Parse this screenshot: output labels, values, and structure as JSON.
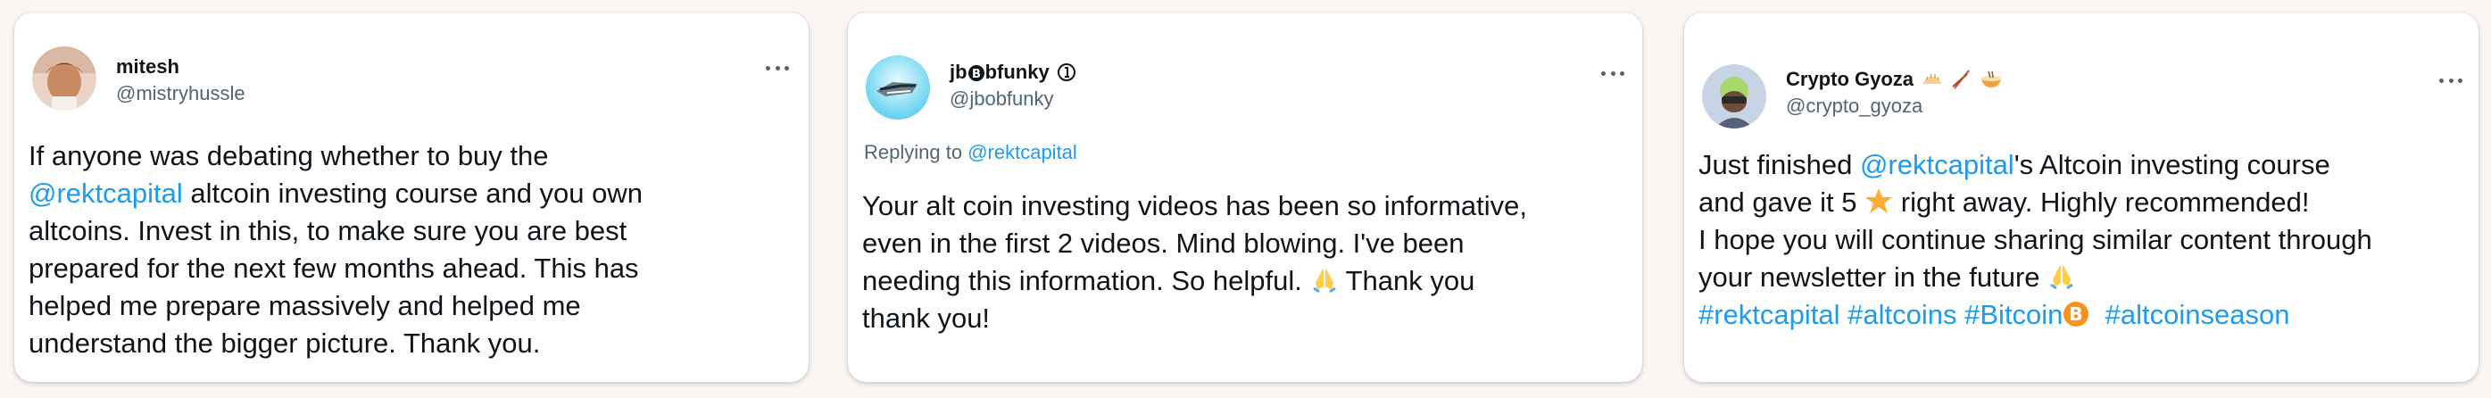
{
  "tweets": [
    {
      "name": "mitesh",
      "handle": "@mistryhussle",
      "body": {
        "l1": "If anyone was debating whether to buy the",
        "l2_link": "@rektcapital",
        "l2_rest": " altcoin investing course and you own",
        "l3": "altcoins. Invest in this, to make sure you are best",
        "l4": "prepared for the next few months ahead. This has",
        "l5": "helped me prepare massively and helped me",
        "l6": "understand the bigger picture. Thank you."
      }
    },
    {
      "name_part1": "jb",
      "name_part2": "bfunky",
      "handle": "@jbobfunky",
      "reply_prefix": "Replying to",
      "reply_link": "@rektcapital",
      "body": {
        "l1": "Your alt coin investing videos has been so informative,",
        "l2": "even in the first 2 videos. Mind blowing. I've been",
        "l3_a": "needing this information. So helpful.",
        "l3_b": "Thank you",
        "l4": "thank you!"
      }
    },
    {
      "name": "Crypto Gyoza",
      "handle": "@crypto_gyoza",
      "body": {
        "l1_a": "Just finished ",
        "l1_link": "@rektcapital",
        "l1_b": "'s Altcoin investing course",
        "l2_a": "and gave it 5",
        "l2_b": "right away. Highly recommended!",
        "l3": "I hope you will continue sharing similar content through",
        "l4": "your newsletter in the future",
        "tag1": "#rektcapital",
        "tag2": "#altcoins",
        "tag3": "#Bitcoin",
        "tag4": "#altcoinseason"
      }
    }
  ],
  "colors": {
    "link": "#1d9bf0",
    "text": "#0f1419",
    "secondary": "#536471",
    "background": "#fbf5f3"
  },
  "icons": [
    "more-options-icon",
    "verified-badge-icon",
    "pray-emoji-icon",
    "star-emoji-icon",
    "bitcoin-icon",
    "gyoza-emoji-icon",
    "chopsticks-emoji-icon",
    "noodle-bowl-emoji-icon"
  ]
}
